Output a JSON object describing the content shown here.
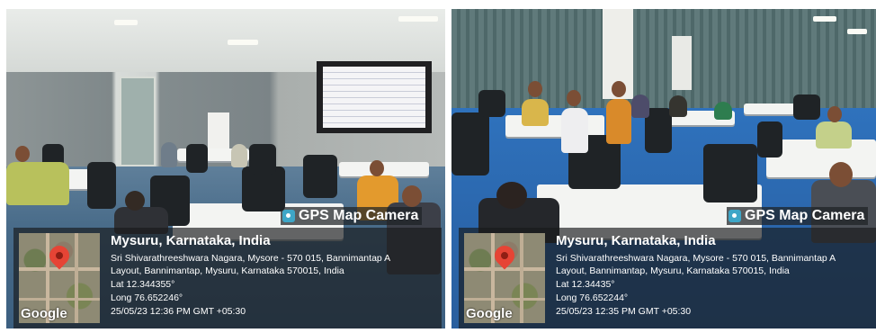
{
  "photos": [
    {
      "brand": "GPS Map Camera",
      "city": "Mysuru, Karnataka, India",
      "address_line1": "Sri Shivarathreeshwara Nagara, Mysore - 570 015, Bannimantap A",
      "address_line2": "Layout, Bannimantap, Mysuru, Karnataka 570015, India",
      "lat": "Lat 12.344355°",
      "long": "Long 76.652246°",
      "timestamp": "25/05/23 12:36 PM GMT +05:30",
      "map_label": "Google"
    },
    {
      "brand": "GPS Map Camera",
      "city": "Mysuru, Karnataka, India",
      "address_line1": "Sri Shivarathreeshwara Nagara, Mysore - 570 015, Bannimantap A",
      "address_line2": "Layout, Bannimantap, Mysuru, Karnataka 570015, India",
      "lat": "Lat 12.34435°",
      "long": "Long 76.652244°",
      "timestamp": "25/05/23 12:35 PM GMT +05:30",
      "map_label": "Google"
    }
  ],
  "colors": {
    "overlay": "#1e2226",
    "pin": "#e64435",
    "floor_left": "#476a88",
    "floor_right": "#2b67ad"
  },
  "icons": [
    "camera-app-icon",
    "map-pin-icon"
  ]
}
